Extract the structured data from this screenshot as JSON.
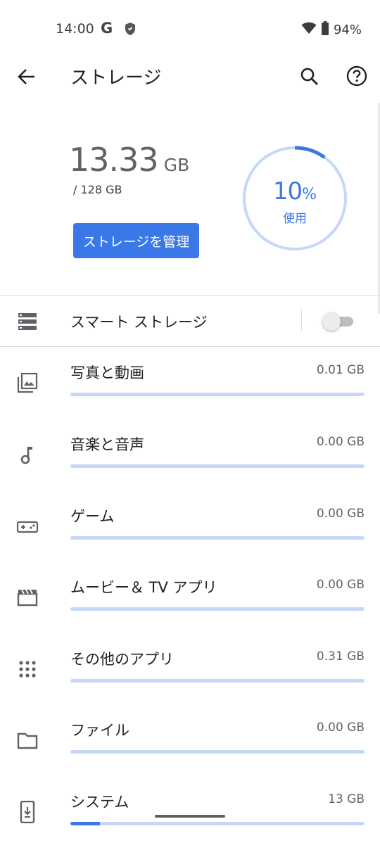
{
  "status_bar": {
    "time": "14:00",
    "google_letter": "G",
    "battery_percent": "94%",
    "icons": [
      "google-g-icon",
      "shield-icon",
      "wifi-icon",
      "battery-icon"
    ]
  },
  "app_bar": {
    "title": "ストレージ",
    "icons": [
      "back-arrow-icon",
      "search-icon",
      "help-icon"
    ]
  },
  "summary": {
    "used_value": "13.33",
    "used_unit": "GB",
    "total": "/ 128 GB",
    "manage_button": "ストレージを管理",
    "ring_percent_num": "10",
    "ring_percent_sign": "%",
    "ring_percent_value": 10,
    "ring_label": "使用"
  },
  "smart_storage": {
    "label": "スマート ストレージ",
    "enabled": false,
    "icon": "storage-stack-icon"
  },
  "categories": [
    {
      "name": "写真と動画",
      "size": "0.01 GB",
      "fill_fraction": 0.0,
      "icon": "photos-icon"
    },
    {
      "name": "音楽と音声",
      "size": "0.00 GB",
      "fill_fraction": 0.0,
      "icon": "music-note-icon"
    },
    {
      "name": "ゲーム",
      "size": "0.00 GB",
      "fill_fraction": 0.0,
      "icon": "gamepad-icon"
    },
    {
      "name": "ムービー＆ TV アプリ",
      "size": "0.00 GB",
      "fill_fraction": 0.0,
      "icon": "movie-clapper-icon"
    },
    {
      "name": "その他のアプリ",
      "size": "0.31 GB",
      "fill_fraction": 0.0,
      "icon": "apps-grid-icon"
    },
    {
      "name": "ファイル",
      "size": "0.00 GB",
      "fill_fraction": 0.0,
      "icon": "folder-icon"
    },
    {
      "name": "システム",
      "size": "13 GB",
      "fill_fraction": 0.1,
      "icon": "system-phone-icon"
    }
  ],
  "colors": {
    "accent": "#3b78e7",
    "ring_track": "#c6d8f7",
    "bar_track": "#c6d8f7"
  }
}
